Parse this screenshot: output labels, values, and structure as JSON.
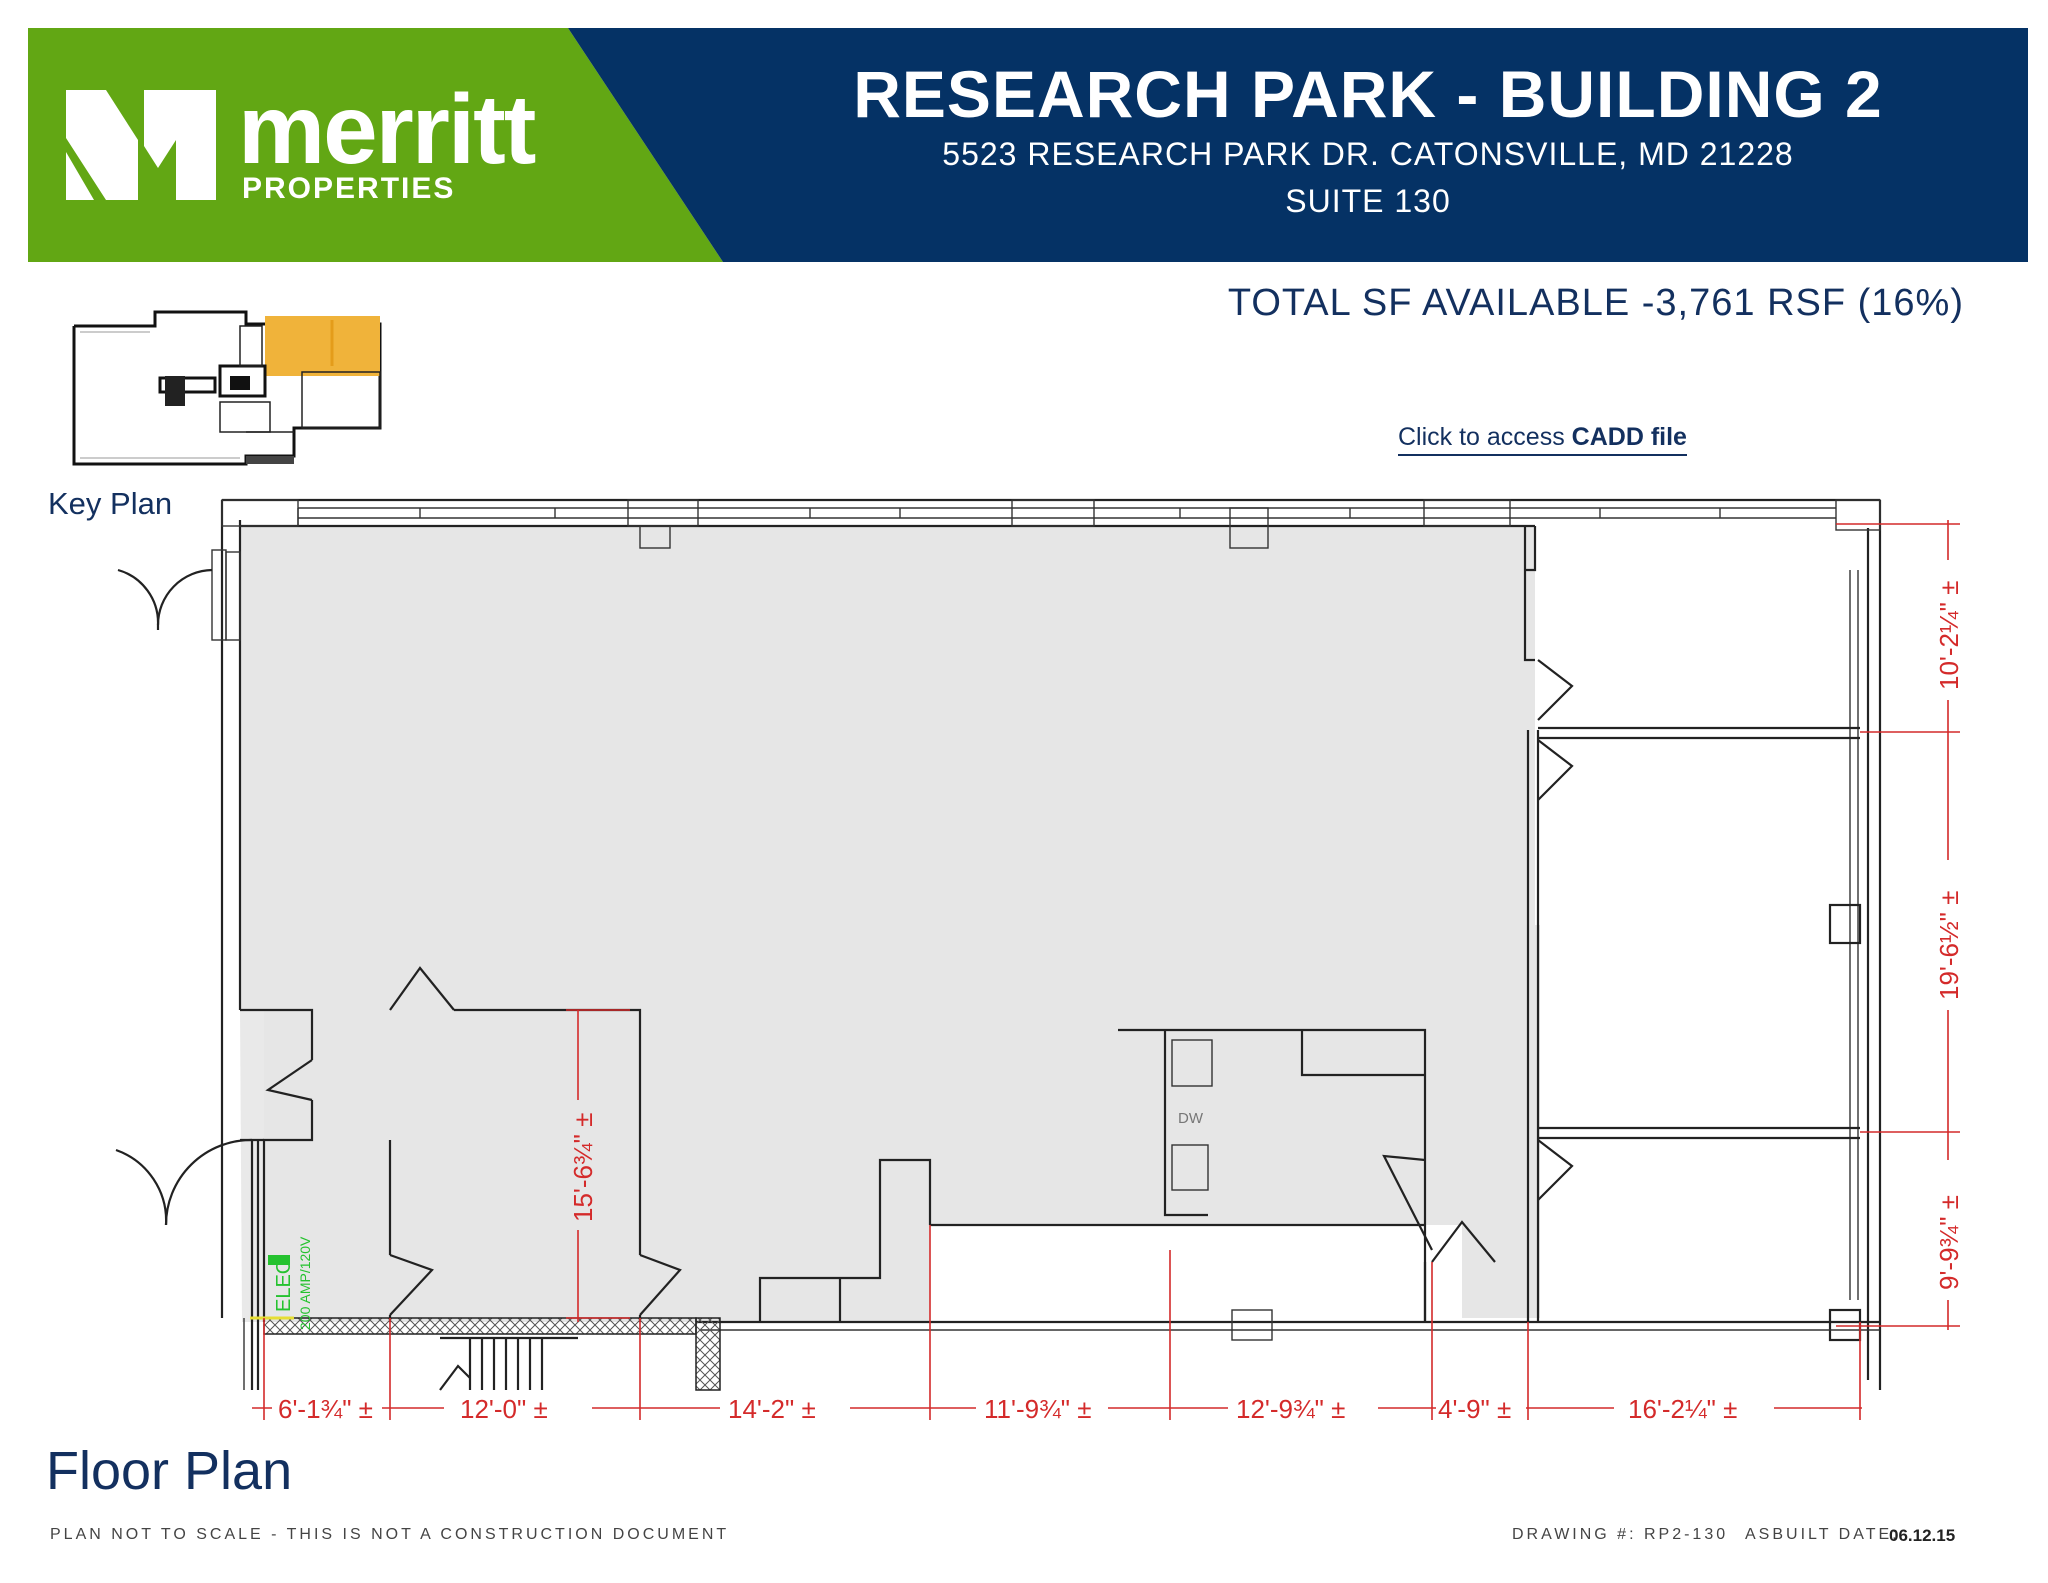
{
  "header": {
    "logo_word": "merritt",
    "logo_sub": "PROPERTIES",
    "title": "RESEARCH PARK - BUILDING 2",
    "address": "5523 RESEARCH PARK DR. CATONSVILLE, MD 21228",
    "suite": "SUITE 130"
  },
  "total_sf": "TOTAL SF AVAILABLE -3,761 RSF (16%)",
  "cadd_link": {
    "prefix": "Click to access ",
    "bold": "CADD file"
  },
  "key_plan_label": "Key Plan",
  "floor_plan_label": "Floor Plan",
  "plan": {
    "elec_label": "ELEC.",
    "elec_sub": "200 AMP/120V",
    "dw_label": "DW",
    "bottom_dims": [
      "6'-1¾\" ±",
      "12'-0\" ±",
      "14'-2\" ±",
      "11'-9¾\" ±",
      "12'-9¾\" ±",
      "4'-9\" ±",
      "16'-2¼\" ±"
    ],
    "right_dims": [
      "10'-2¼\" ±",
      "19'-6½\" ±",
      "9'-9¾\" ±"
    ],
    "interior_dim": "15'-6¾\" ±"
  },
  "footer": {
    "disclaimer": "PLAN NOT TO SCALE - THIS IS NOT A CONSTRUCTION DOCUMENT",
    "drawing": "DRAWING #: RP2-130",
    "asbuilt_label": "ASBUILT DATE:",
    "asbuilt_date": "06.12.15"
  },
  "colors": {
    "green": "#62a714",
    "navy": "#053265",
    "orange": "#f0b33a",
    "dim_red": "#d42a2a",
    "floor": "#e6e6e6"
  }
}
